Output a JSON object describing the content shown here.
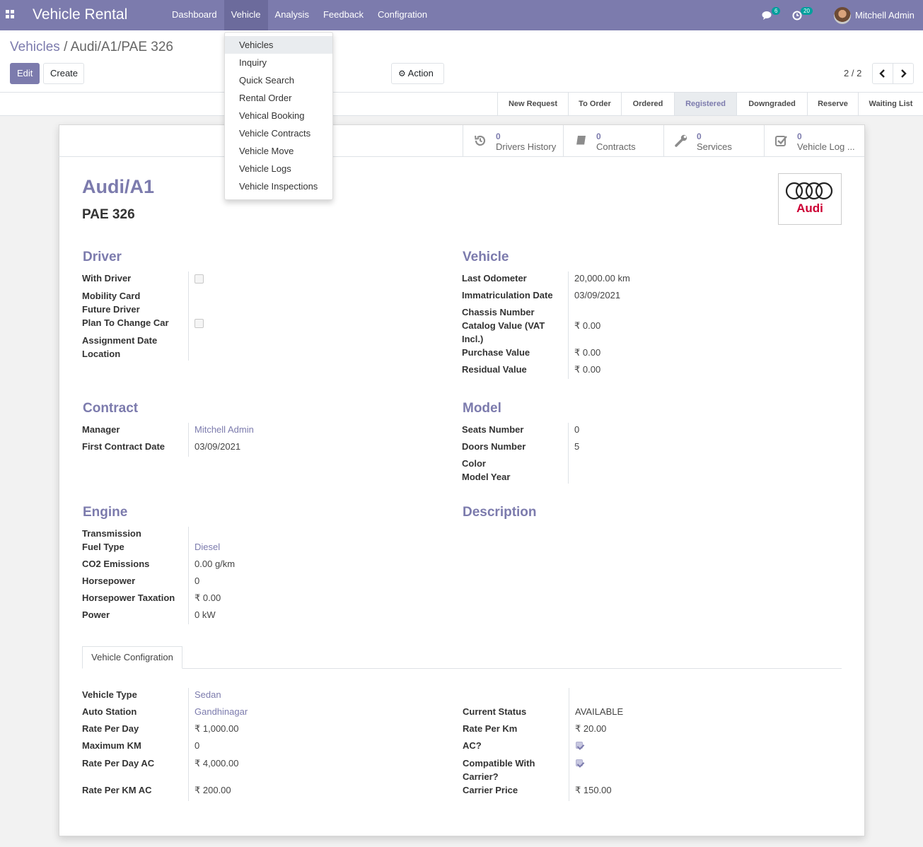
{
  "app": {
    "title": "Vehicle Rental"
  },
  "menu": {
    "items": [
      "Dashboard",
      "Vehicle",
      "Analysis",
      "Feedback",
      "Configration"
    ],
    "active": "Vehicle"
  },
  "systray": {
    "messages_count": "6",
    "activities_count": "20",
    "user_name": "Mitchell Admin"
  },
  "breadcrumb": {
    "parent": "Vehicles",
    "separator": "/",
    "current": "Audi/A1/PAE 326"
  },
  "buttons": {
    "edit": "Edit",
    "create": "Create",
    "action": "Action"
  },
  "pager": {
    "value": "2 / 2"
  },
  "stages": {
    "items": [
      "New Request",
      "To Order",
      "Ordered",
      "Registered",
      "Downgraded",
      "Reserve",
      "Waiting List"
    ],
    "current": "Registered"
  },
  "stat_buttons": [
    {
      "count": "0",
      "label": "Drivers History",
      "icon": "history-icon"
    },
    {
      "count": "0",
      "label": "Contracts",
      "icon": "book-icon"
    },
    {
      "count": "0",
      "label": "Services",
      "icon": "wrench-icon"
    },
    {
      "count": "0",
      "label": "Vehicle Log ...",
      "icon": "check-square-icon"
    }
  ],
  "record": {
    "title": "Audi/A1",
    "plate": "PAE 326",
    "logo_text": "Audi"
  },
  "driver": {
    "heading": "Driver",
    "labels": {
      "with_driver": "With Driver",
      "mobility_card": "Mobility Card",
      "future_driver": "Future Driver",
      "plan_to_change": "Plan To Change Car",
      "assignment_date": "Assignment Date",
      "location": "Location"
    }
  },
  "vehicle": {
    "heading": "Vehicle",
    "labels": {
      "odometer": "Last Odometer",
      "immat": "Immatriculation Date",
      "chassis": "Chassis Number",
      "catalog": "Catalog Value (VAT Incl.)",
      "purchase": "Purchase Value",
      "residual": "Residual Value"
    },
    "values": {
      "odometer": "20,000.00",
      "odometer_unit": "km",
      "immat": "03/09/2021",
      "catalog": "₹ 0.00",
      "purchase": "₹ 0.00",
      "residual": "₹ 0.00"
    }
  },
  "contract": {
    "heading": "Contract",
    "labels": {
      "manager": "Manager",
      "first_date": "First Contract Date"
    },
    "values": {
      "manager": "Mitchell Admin",
      "first_date": "03/09/2021"
    }
  },
  "model": {
    "heading": "Model",
    "labels": {
      "seats": "Seats Number",
      "doors": "Doors Number",
      "color": "Color",
      "year": "Model Year"
    },
    "values": {
      "seats": "0",
      "doors": "5"
    }
  },
  "engine": {
    "heading": "Engine",
    "labels": {
      "transmission": "Transmission",
      "fuel": "Fuel Type",
      "co2": "CO2 Emissions",
      "hp": "Horsepower",
      "hp_tax": "Horsepower Taxation",
      "power": "Power"
    },
    "values": {
      "fuel": "Diesel",
      "co2": "0.00",
      "co2_unit": "g/km",
      "hp": "0",
      "hp_tax": "₹ 0.00",
      "power": "0",
      "power_unit": "kW"
    }
  },
  "description": {
    "heading": "Description"
  },
  "config_tab": {
    "label": "Vehicle Configration",
    "labels": {
      "type": "Vehicle Type",
      "station": "Auto Station",
      "rate_day": "Rate Per Day",
      "max_km": "Maximum KM",
      "rate_day_ac": "Rate Per Day AC",
      "rate_km_ac": "Rate Per KM AC",
      "status": "Current Status",
      "rate_km": "Rate Per Km",
      "ac": "AC?",
      "carrier": "Compatible With Carrier?",
      "carrier_price": "Carrier Price"
    },
    "values": {
      "type": "Sedan",
      "station": "Gandhinagar",
      "rate_day": "₹ 1,000.00",
      "max_km": "0",
      "rate_day_ac": "₹ 4,000.00",
      "rate_km_ac": "₹ 200.00",
      "status": "AVAILABLE",
      "rate_km": "₹ 20.00",
      "carrier_price": "₹ 150.00"
    }
  },
  "dropdown": {
    "items": [
      "Vehicles",
      "Inquiry",
      "Quick Search",
      "Rental Order",
      "Vehical Booking",
      "Vehicle Contracts",
      "Vehicle Move",
      "Vehicle Logs",
      "Vehicle Inspections"
    ],
    "highlighted": "Vehicles"
  },
  "colors": {
    "brand": "#7c7bad",
    "audi_red": "#cc0033"
  }
}
